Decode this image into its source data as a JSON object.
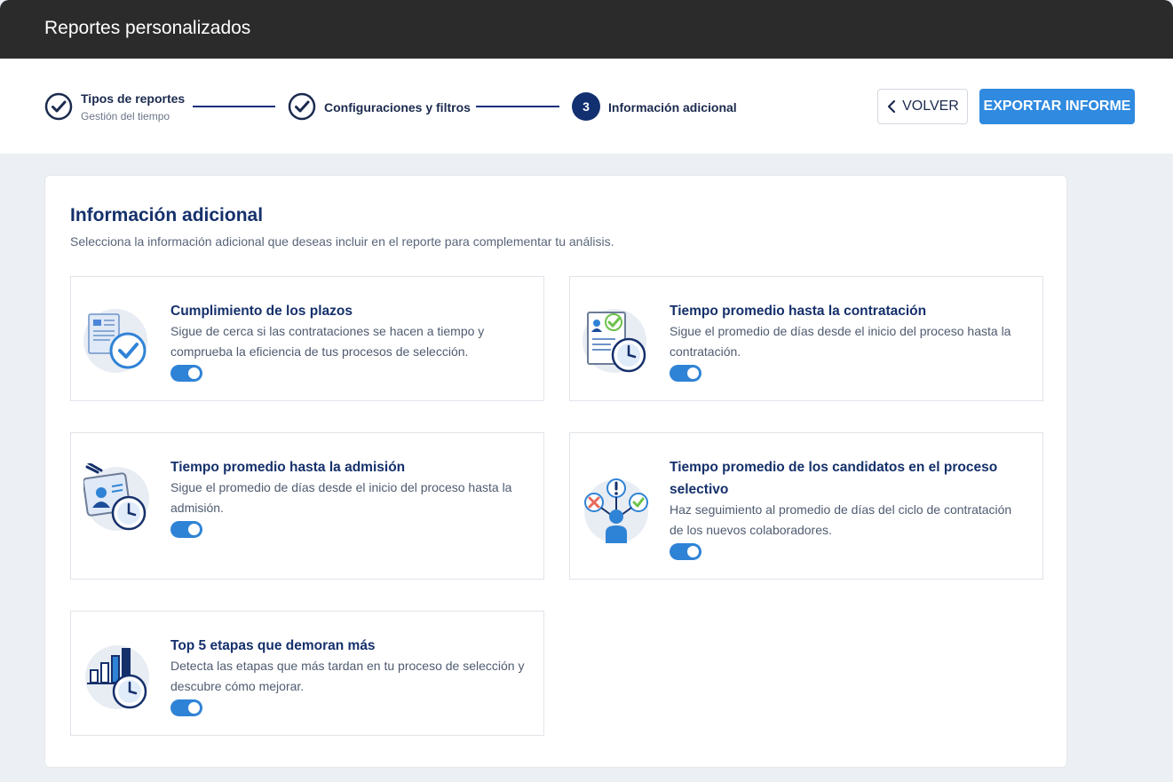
{
  "window": {
    "title": "Reportes personalizados"
  },
  "stepper": {
    "steps": [
      {
        "label": "Tipos de reportes",
        "sublabel": "Gestión del tiempo",
        "state": "completed"
      },
      {
        "label": "Configuraciones y filtros",
        "state": "completed"
      },
      {
        "number": "3",
        "label": "Información adicional",
        "state": "active"
      }
    ]
  },
  "actions": {
    "back_label": "VOLVER",
    "export_label": "EXPORTAR INFORME"
  },
  "panel": {
    "title": "Información adicional",
    "subtitle": "Selecciona la información adicional que deseas incluir en el reporte para complementar tu análisis."
  },
  "cards": [
    {
      "title": "Cumplimiento de los plazos",
      "description": "Sigue de cerca si las contrataciones se hacen a tiempo y comprueba la eficiencia de tus procesos de selección.",
      "enabled": true,
      "icon": "document-check-icon"
    },
    {
      "title": "Tiempo promedio hasta la contratación",
      "description": "Sigue el promedio de días desde el inicio del proceso hasta la contratación.",
      "enabled": true,
      "icon": "checklist-clock-icon"
    },
    {
      "title": "Tiempo promedio hasta la admisión",
      "description": "Sigue el promedio de días desde el inicio del proceso hasta la admisión.",
      "enabled": true,
      "icon": "badge-clock-icon"
    },
    {
      "title": "Tiempo promedio de los candidatos en el proceso selectivo",
      "description": "Haz seguimiento al promedio de días del ciclo de contratación de los nuevos colaboradores.",
      "enabled": true,
      "icon": "candidate-decision-icon"
    },
    {
      "title": "Top 5 etapas que demoran más",
      "description": "Detecta las etapas que más tardan en tu proceso de selección y descubre cómo mejorar.",
      "enabled": true,
      "icon": "bar-chart-clock-icon"
    }
  ],
  "colors": {
    "navy": "#15306b",
    "accent": "#2f8ae0",
    "toggle": "#2f83d6",
    "titlebar": "#2b2b2b"
  }
}
